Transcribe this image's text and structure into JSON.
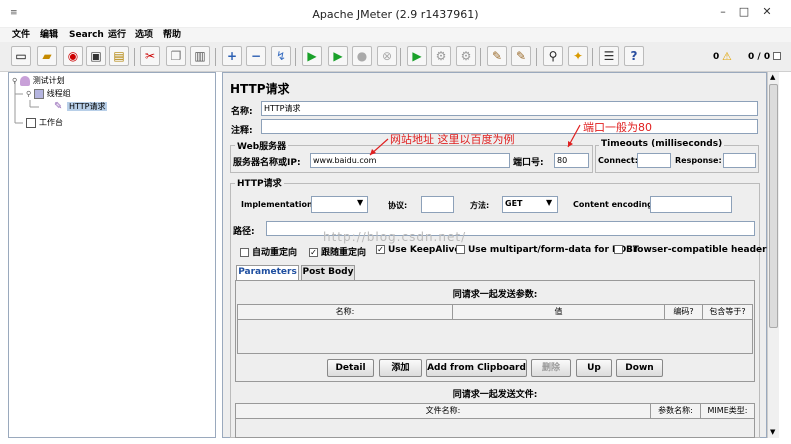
{
  "window": {
    "title": "Apache JMeter (2.9 r1437961)"
  },
  "menu": [
    "文件",
    "编辑",
    "Search",
    "运行",
    "选项",
    "帮助"
  ],
  "toolbar": {
    "status_count": "0",
    "status_threads": "0 / 0",
    "icons": [
      "new-icon",
      "open-icon",
      "open-recent-icon",
      "save-icon",
      "save-as-icon",
      "cut-icon",
      "copy-icon",
      "paste-icon",
      "expand-icon",
      "collapse-icon",
      "toggle-icon",
      "start-icon",
      "start-no-pause-icon",
      "stop-icon",
      "shutdown-icon",
      "remote-start-icon",
      "remote-stop-icon",
      "remote-exit-icon",
      "clear-icon",
      "clear-all-icon",
      "search-icon",
      "reset-search-icon",
      "function-helper-icon",
      "help-icon"
    ]
  },
  "tree": {
    "items": [
      "测试计划",
      "线程组",
      "HTTP请求",
      "工作台"
    ]
  },
  "panel": {
    "title": "HTTP请求",
    "name_label": "名称:",
    "name_value": "HTTP请求",
    "comment_label": "注释:",
    "web_server_label": "Web服务器",
    "server_label": "服务器名称或IP:",
    "server_value": "www.baidu.com",
    "port_label": "端口号:",
    "port_value": "80",
    "timeouts_label": "Timeouts (milliseconds)",
    "connect_label": "Connect:",
    "response_label": "Response:",
    "http_request_label": "HTTP请求",
    "implementation_label": "Implementation:",
    "protocol_label": "协议:",
    "method_label": "方法:",
    "method_value": "GET",
    "encoding_label": "Content encoding:",
    "path_label": "路径:",
    "checkboxes": [
      {
        "label": "自动重定向",
        "checked": false
      },
      {
        "label": "跟随重定向",
        "checked": true
      },
      {
        "label": "Use KeepAlive",
        "checked": true
      },
      {
        "label": "Use multipart/form-data for POST",
        "checked": false
      },
      {
        "label": "Browser-compatible headers",
        "checked": false
      }
    ],
    "tabs": [
      "Parameters",
      "Post Body"
    ],
    "params_title": "同请求一起发送参数:",
    "params_columns": [
      "名称:",
      "值",
      "编码?",
      "包含等于?"
    ],
    "buttons": [
      "Detail",
      "添加",
      "Add from Clipboard",
      "删除",
      "Up",
      "Down"
    ],
    "files_title": "同请求一起发送文件:",
    "files_columns": [
      "文件名称:",
      "参数名称:",
      "MIME类型:"
    ]
  },
  "annotations": {
    "site_note": "网站地址 这里以百度为例",
    "port_note": "端口一般为80",
    "watermark": "http://blog.csdn.net/"
  },
  "colors": {
    "annotation": "#e02020",
    "border": "#8da1b9"
  }
}
